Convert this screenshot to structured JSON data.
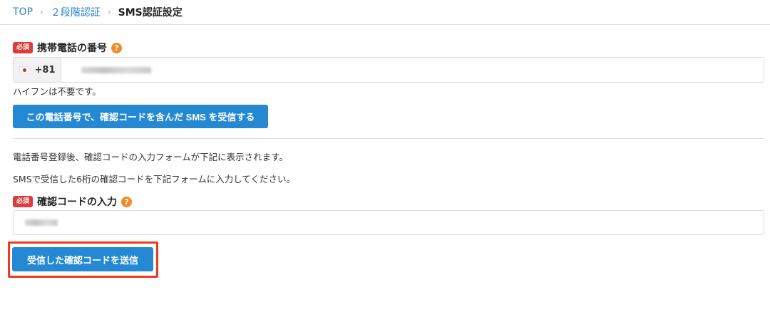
{
  "breadcrumb": {
    "items": [
      {
        "label": "TOP"
      },
      {
        "label": "２段階認証"
      }
    ],
    "current": "SMS認証設定",
    "separator": "›"
  },
  "phone_section": {
    "required_badge": "必須",
    "label": "携帯電話の番号",
    "help_icon": "?",
    "country_code": "+81",
    "country_flag": "japan-flag",
    "hint": "ハイフンは不要です。",
    "send_button": "この電話番号で、確認コードを含んだ SMS を受信する"
  },
  "notes": [
    "電話番号登録後、確認コードの入力フォームが下記に表示されます。",
    "SMSで受信した6桁の確認コードを下記フォームに入力してください。"
  ],
  "code_section": {
    "required_badge": "必須",
    "label": "確認コードの入力",
    "help_icon": "?",
    "submit_button": "受信した確認コードを送信"
  },
  "colors": {
    "link": "#2b86cc",
    "button": "#2588d3",
    "required_badge": "#e03a3a",
    "help_icon": "#f08a24",
    "highlight_box": "#ee3a1d"
  }
}
